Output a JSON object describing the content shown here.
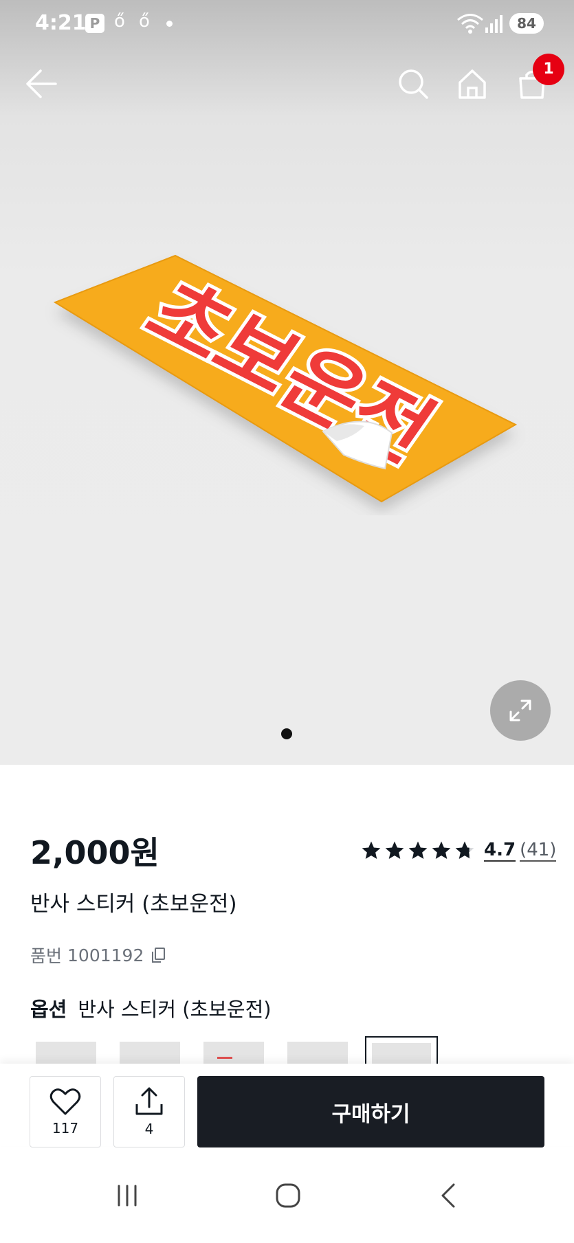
{
  "status_bar": {
    "time": "4:21",
    "p_badge": "P",
    "notif_glyph_1": "ő",
    "notif_glyph_2": "ő",
    "battery": "84",
    "icons": [
      "wifi-icon",
      "signal-icon",
      "battery-icon"
    ]
  },
  "top_nav": {
    "cart_badge": "1",
    "icons": [
      "back-arrow-icon",
      "search-icon",
      "home-icon",
      "shopping-bag-icon"
    ]
  },
  "hero": {
    "sticker_text": "초보운전",
    "page_indicator": {
      "current": 1,
      "total": 1
    },
    "icons": [
      "expand-icon"
    ]
  },
  "product": {
    "price": "2,000원",
    "rating": {
      "stars": 4.7,
      "score": "4.7",
      "count": "(41)"
    },
    "name": "반사 스티커 (초보운전)",
    "sku_label": "품번",
    "sku_value": "1001192",
    "option_label": "옵션",
    "option_value": "반사 스티커 (초보운전)"
  },
  "bottom_bar": {
    "like_count": "117",
    "share_count": "4",
    "buy_label": "구매하기"
  },
  "colors": {
    "primary_dark": "#191d24",
    "badge_red": "#e60012",
    "sticker_yellow": "#f7ab1e",
    "sticker_red": "#ef3b39"
  }
}
